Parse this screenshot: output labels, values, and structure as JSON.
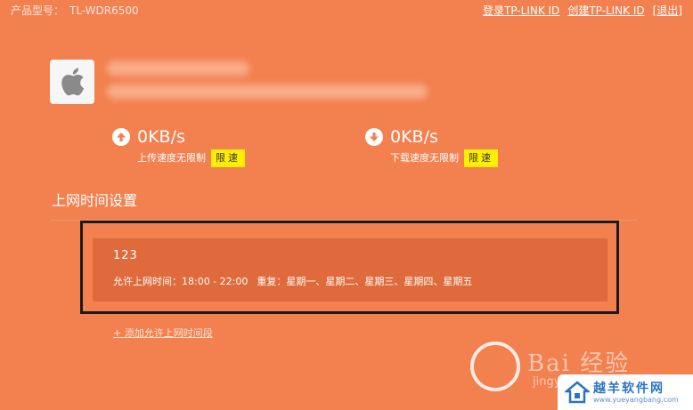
{
  "header": {
    "model_label": "产品型号：",
    "model_value": "TL-WDR6500",
    "links": [
      "登录TP-LINK ID",
      "创建TP-LINK ID",
      "[退出]"
    ]
  },
  "device": {
    "icon": "apple-icon"
  },
  "speeds": {
    "upload": {
      "value": "0KB/s",
      "caption": "上传速度无限制",
      "button": "限速",
      "icon": "arrow-up-icon"
    },
    "download": {
      "value": "0KB/s",
      "caption": "下载速度无限制",
      "button": "限速",
      "icon": "arrow-down-icon"
    }
  },
  "section": {
    "title": "上网时间设置",
    "item": {
      "name": "123",
      "time": "允许上网时间：18:00 - 22:00",
      "repeat": "重复：星期一、星期二、星期三、星期四、星期五"
    },
    "add_link": "+ 添加允许上网时间段"
  },
  "watermark": {
    "text": "Bai 经验",
    "sub": "jingyan",
    "site_name": "越羊软件网",
    "site_url": "www.yueyangbang.com"
  },
  "colors": {
    "background": "#f3804f",
    "item_background": "#df6a3c",
    "limit_button": "#ffee00",
    "highlight_frame": "#1a1a1a"
  }
}
